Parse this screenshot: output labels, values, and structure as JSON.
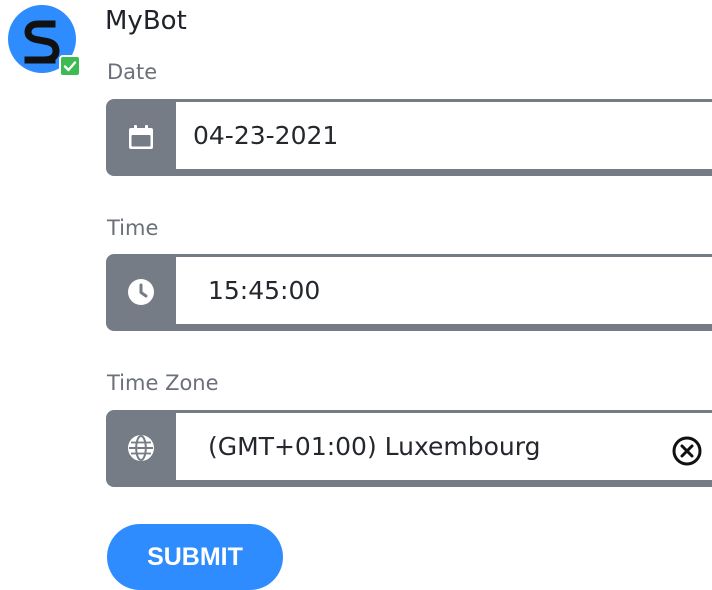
{
  "bot": {
    "name": "MyBot",
    "avatar_letter": "S",
    "status": "online"
  },
  "form": {
    "date": {
      "label": "Date",
      "value": "04-23-2021",
      "icon": "calendar-icon"
    },
    "time": {
      "label": "Time",
      "value": "15:45:00",
      "icon": "clock-icon"
    },
    "timezone": {
      "label": "Time Zone",
      "value": "(GMT+01:00) Luxembourg",
      "icon": "globe-icon",
      "clear_icon": "clear-icon"
    },
    "submit_label": "SUBMIT"
  },
  "colors": {
    "brand_blue": "#2f8cff",
    "field_gray": "#767c85",
    "status_green": "#3dbb52"
  }
}
